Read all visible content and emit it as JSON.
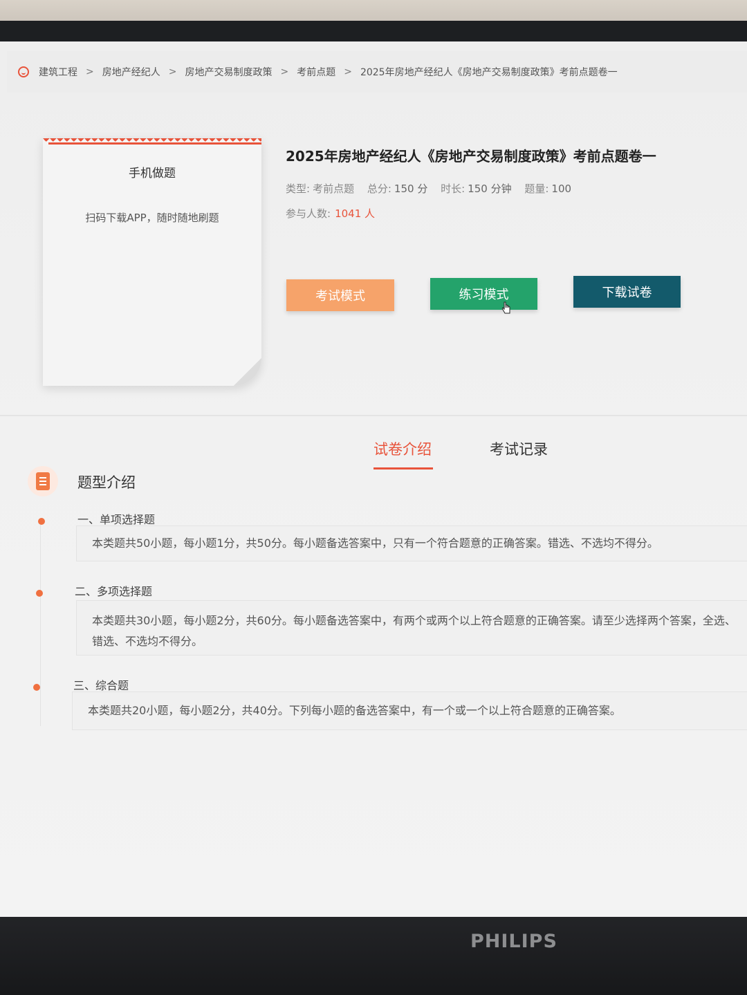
{
  "breadcrumb": {
    "items": [
      "建筑工程",
      "房地产经纪人",
      "房地产交易制度政策",
      "考前点题",
      "2025年房地产经纪人《房地产交易制度政策》考前点题卷一"
    ],
    "separator": ">"
  },
  "phone_card": {
    "title": "手机做题",
    "subtitle": "扫码下载APP，随时随地刷题"
  },
  "paper": {
    "title": "2025年房地产经纪人《房地产交易制度政策》考前点题卷一",
    "type_label": "类型:",
    "type_value": "考前点题",
    "score_label": "总分:",
    "score_value": "150 分",
    "duration_label": "时长:",
    "duration_value": "150 分钟",
    "count_label": "题量:",
    "count_value": "100",
    "participants_label": "参与人数:",
    "participants_value": "1041 人"
  },
  "buttons": {
    "exam_mode": "考试模式",
    "practice_mode": "练习模式",
    "download": "下载试卷"
  },
  "tabs": {
    "intro": "试卷介绍",
    "records": "考试记录"
  },
  "section": {
    "title": "题型介绍",
    "items": [
      {
        "heading": "一、单项选择题",
        "desc": "本类题共50小题，每小题1分，共50分。每小题备选答案中，只有一个符合题意的正确答案。错选、不选均不得分。"
      },
      {
        "heading": "二、多项选择题",
        "desc": "本类题共30小题，每小题2分，共60分。每小题备选答案中，有两个或两个以上符合题意的正确答案。请至少选择两个答案，全选、错选、不选均不得分。"
      },
      {
        "heading": "三、综合题",
        "desc": "本类题共20小题，每小题2分，共40分。下列每小题的备选答案中，有一个或一个以上符合题意的正确答案。"
      }
    ]
  },
  "monitor_brand": "PHILIPS",
  "colors": {
    "accent": "#e8533a",
    "exam_button": "#f6a36a",
    "practice_button": "#24a36b",
    "download_button": "#135a6b"
  }
}
